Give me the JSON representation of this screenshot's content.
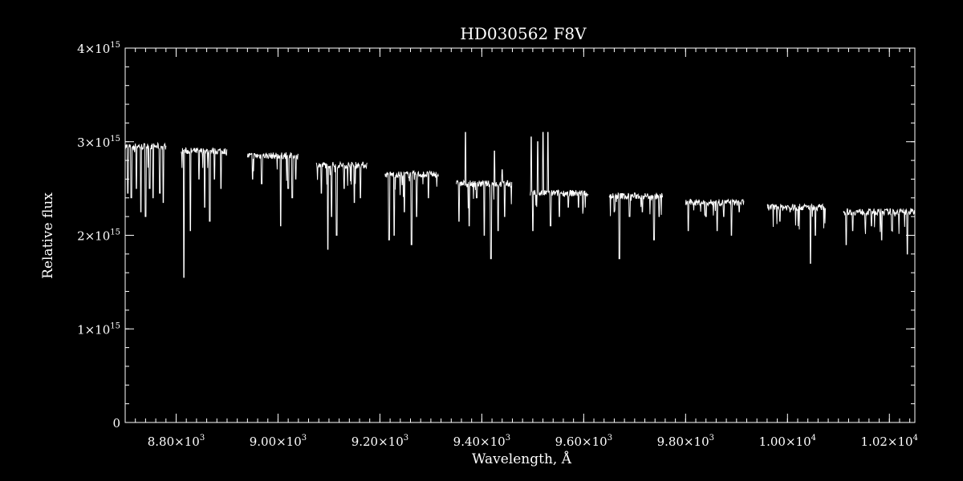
{
  "chart_data": {
    "type": "line",
    "title": "HD030562  F8V",
    "xlabel": "Wavelength, Å",
    "ylabel": "Relative flux",
    "xlim": [
      8700,
      10250
    ],
    "ylim": [
      0,
      4000000000000000.0
    ],
    "grid": false,
    "x_ticks": [
      {
        "value": 8800,
        "mantissa": "8.80",
        "exp": "3"
      },
      {
        "value": 9000,
        "mantissa": "9.00",
        "exp": "3"
      },
      {
        "value": 9200,
        "mantissa": "9.20",
        "exp": "3"
      },
      {
        "value": 9400,
        "mantissa": "9.40",
        "exp": "3"
      },
      {
        "value": 9600,
        "mantissa": "9.60",
        "exp": "3"
      },
      {
        "value": 9800,
        "mantissa": "9.80",
        "exp": "3"
      },
      {
        "value": 10000,
        "mantissa": "1.00",
        "exp": "4"
      },
      {
        "value": 10200,
        "mantissa": "1.02",
        "exp": "4"
      }
    ],
    "y_ticks": [
      {
        "value": 0,
        "mantissa": "0",
        "exp": ""
      },
      {
        "value": 1000000000000000.0,
        "mantissa": "1",
        "exp": "15"
      },
      {
        "value": 2000000000000000.0,
        "mantissa": "2",
        "exp": "15"
      },
      {
        "value": 3000000000000000.0,
        "mantissa": "3",
        "exp": "15"
      },
      {
        "value": 4000000000000000.0,
        "mantissa": "4",
        "exp": "15"
      }
    ],
    "x_minor_step": 20,
    "y_minor_step": 200000000000000.0,
    "series": [
      {
        "segments": [
          {
            "x0": 8700,
            "x1": 8780,
            "base": 2950000000000000.0,
            "dips": [
              [
                8705,
                2450000000000000.0
              ],
              [
                8712,
                2400000000000000.0
              ],
              [
                8722,
                2500000000000000.0
              ],
              [
                8731,
                2250000000000000.0
              ],
              [
                8740,
                2200000000000000.0
              ],
              [
                8748,
                2500000000000000.0
              ],
              [
                8755,
                2400000000000000.0
              ],
              [
                8768,
                2450000000000000.0
              ],
              [
                8775,
                2350000000000000.0
              ]
            ]
          },
          {
            "x0": 8810,
            "x1": 8900,
            "base": 2900000000000000.0,
            "dips": [
              [
                8815,
                1550000000000000.0
              ],
              [
                8828,
                2050000000000000.0
              ],
              [
                8845,
                2600000000000000.0
              ],
              [
                8856,
                2300000000000000.0
              ],
              [
                8866,
                2150000000000000.0
              ],
              [
                8875,
                2600000000000000.0
              ],
              [
                8888,
                2500000000000000.0
              ]
            ]
          },
          {
            "x0": 8940,
            "x1": 9040,
            "base": 2850000000000000.0,
            "dips": [
              [
                8950,
                2600000000000000.0
              ],
              [
                8968,
                2550000000000000.0
              ],
              [
                9005,
                2100000000000000.0
              ],
              [
                9020,
                2500000000000000.0
              ],
              [
                9028,
                2400000000000000.0
              ],
              [
                9035,
                2600000000000000.0
              ]
            ]
          },
          {
            "x0": 9075,
            "x1": 9175,
            "base": 2750000000000000.0,
            "dips": [
              [
                9085,
                2450000000000000.0
              ],
              [
                9098,
                1850000000000000.0
              ],
              [
                9105,
                2200000000000000.0
              ],
              [
                9115,
                2000000000000000.0
              ],
              [
                9130,
                2500000000000000.0
              ],
              [
                9150,
                2350000000000000.0
              ],
              [
                9162,
                2400000000000000.0
              ]
            ]
          },
          {
            "x0": 9210,
            "x1": 9315,
            "base": 2650000000000000.0,
            "dips": [
              [
                9218,
                1950000000000000.0
              ],
              [
                9228,
                2000000000000000.0
              ],
              [
                9248,
                2250000000000000.0
              ],
              [
                9262,
                1900000000000000.0
              ],
              [
                9272,
                2200000000000000.0
              ],
              [
                9295,
                2400000000000000.0
              ]
            ]
          },
          {
            "x0": 9350,
            "x1": 9460,
            "base": 2550000000000000.0,
            "dips": [
              [
                9355,
                2150000000000000.0
              ],
              [
                9375,
                2100000000000000.0
              ],
              [
                9390,
                2400000000000000.0
              ],
              [
                9405,
                2000000000000000.0
              ],
              [
                9418,
                1750000000000000.0
              ],
              [
                9432,
                2050000000000000.0
              ],
              [
                9445,
                2200000000000000.0
              ]
            ],
            "spikes": [
              [
                9368,
                3100000000000000.0
              ],
              [
                9425,
                2900000000000000.0
              ],
              [
                9440,
                2700000000000000.0
              ]
            ]
          },
          {
            "x0": 9495,
            "x1": 9610,
            "base": 2450000000000000.0,
            "dips": [
              [
                9500,
                2050000000000000.0
              ],
              [
                9520,
                2000000000000000.0
              ],
              [
                9535,
                2100000000000000.0
              ],
              [
                9552,
                2200000000000000.0
              ],
              [
                9570,
                2300000000000000.0
              ],
              [
                9590,
                2300000000000000.0
              ]
            ],
            "spikes": [
              [
                9497,
                3050000000000000.0
              ],
              [
                9510,
                3000000000000000.0
              ],
              [
                9520,
                3100000000000000.0
              ],
              [
                9530,
                3100000000000000.0
              ]
            ]
          },
          {
            "x0": 9650,
            "x1": 9755,
            "base": 2420000000000000.0,
            "dips": [
              [
                9660,
                2250000000000000.0
              ],
              [
                9670,
                1750000000000000.0
              ],
              [
                9690,
                2200000000000000.0
              ],
              [
                9715,
                2250000000000000.0
              ],
              [
                9738,
                1950000000000000.0
              ],
              [
                9748,
                2200000000000000.0
              ]
            ]
          },
          {
            "x0": 9800,
            "x1": 9915,
            "base": 2350000000000000.0,
            "dips": [
              [
                9805,
                2050000000000000.0
              ],
              [
                9840,
                2200000000000000.0
              ],
              [
                9862,
                2050000000000000.0
              ],
              [
                9875,
                2200000000000000.0
              ],
              [
                9890,
                2000000000000000.0
              ],
              [
                9905,
                2250000000000000.0
              ]
            ]
          },
          {
            "x0": 9960,
            "x1": 10075,
            "base": 2300000000000000.0,
            "dips": [
              [
                9985,
                2150000000000000.0
              ],
              [
                10005,
                2250000000000000.0
              ],
              [
                10045,
                1700000000000000.0
              ],
              [
                10055,
                2000000000000000.0
              ]
            ]
          },
          {
            "x0": 10110,
            "x1": 10250,
            "base": 2250000000000000.0,
            "dips": [
              [
                10115,
                1900000000000000.0
              ],
              [
                10128,
                2050000000000000.0
              ],
              [
                10165,
                2100000000000000.0
              ],
              [
                10185,
                1950000000000000.0
              ],
              [
                10205,
                2050000000000000.0
              ],
              [
                10235,
                1800000000000000.0
              ]
            ]
          }
        ]
      }
    ]
  }
}
